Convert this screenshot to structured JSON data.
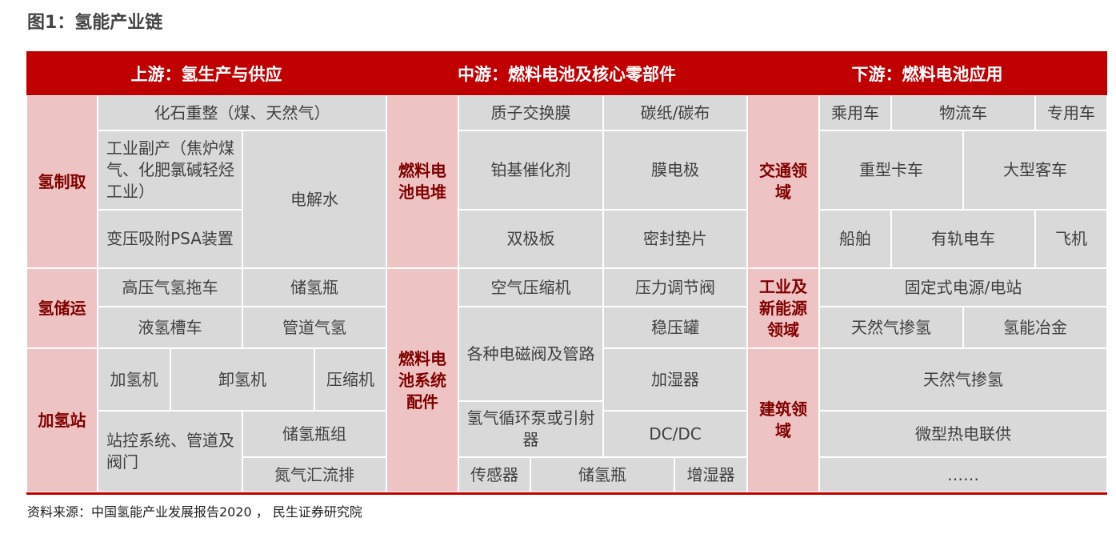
{
  "figure_title": "图1：氢能产业链",
  "source": "资料来源：中国氢能产业发展报告2020 ， 民生证券研究院",
  "colors": {
    "band": "#c00000",
    "category_bg": "#eec3c3",
    "cell_bg": "#d9d9d9",
    "category_text": "#7f0000"
  },
  "upstream": {
    "header": "上游：氢生产与供应",
    "production": {
      "label": "氢制取",
      "fossil": "化石重整（煤、天然气）",
      "industrial": "工业副产（焦炉煤气、化肥氯碱轻烃工业）",
      "psa": "变压吸附PSA装置",
      "electrolysis": "电解水"
    },
    "storage": {
      "label": "氢储运",
      "tube_trailer": "高压气氢拖车",
      "cylinder": "储氢瓶",
      "liquid_tanker": "液氢槽车",
      "pipeline": "管道气氢"
    },
    "station": {
      "label": "加氢站",
      "dispenser": "加氢机",
      "unloader": "卸氢机",
      "compressor": "压缩机",
      "control": "站控系统、管道及阀门",
      "cylinder_group": "储氢瓶组",
      "manifold": "氮气汇流排"
    }
  },
  "midstream": {
    "header": "中游：燃料电池及核心零部件",
    "stack": {
      "label": "燃料电池电堆",
      "pem": "质子交换膜",
      "carbon_paper": "碳纸/碳布",
      "catalyst": "铂基催化剂",
      "mea": "膜电极",
      "bipolar": "双极板",
      "gasket": "密封垫片"
    },
    "system": {
      "label": "燃料电池系统配件",
      "air_compressor": "空气压缩机",
      "pressure_valve": "压力调节阀",
      "solenoid": "各种电磁阀及管路",
      "surge_tank": "稳压罐",
      "humidifier": "加湿器",
      "recirc_pump": "氢气循环泵或引射器",
      "dcdc": "DC/DC",
      "sensor": "传感器",
      "h2_cylinder": "储氢瓶",
      "humidifier2": "增湿器"
    }
  },
  "downstream": {
    "header": "下游：燃料电池应用",
    "transport": {
      "label": "交通领域",
      "passenger": "乘用车",
      "logistics": "物流车",
      "special": "专用车",
      "heavy_truck": "重型卡车",
      "bus": "大型客车",
      "ship": "船舶",
      "rail": "有轨电车",
      "aircraft": "飞机"
    },
    "industry": {
      "label": "工业及新能源领域",
      "stationary": "固定式电源/电站",
      "ng_blend": "天然气掺氢",
      "metallurgy": "氢能冶金"
    },
    "building": {
      "label": "建筑领域",
      "ng_blend": "天然气掺氢",
      "chp": "微型热电联供",
      "more": "……"
    }
  }
}
